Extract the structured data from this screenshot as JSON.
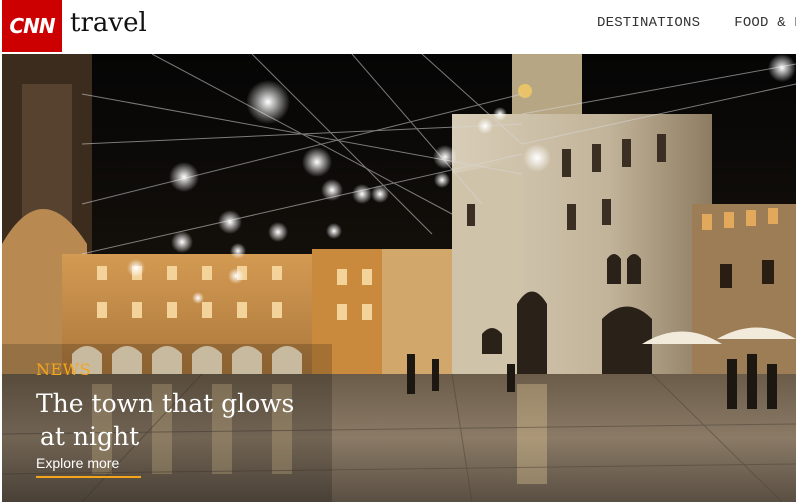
{
  "header": {
    "logo_text": "CNN",
    "brand": "travel",
    "nav": [
      "DESTINATIONS",
      "FOOD & DR"
    ]
  },
  "hero": {
    "kicker": "NEWS",
    "headline_line1": "The town that glows",
    "headline_line2": "at night",
    "cta": "Explore more"
  },
  "colors": {
    "brand_red": "#cc0000",
    "accent": "#f3a61c"
  }
}
